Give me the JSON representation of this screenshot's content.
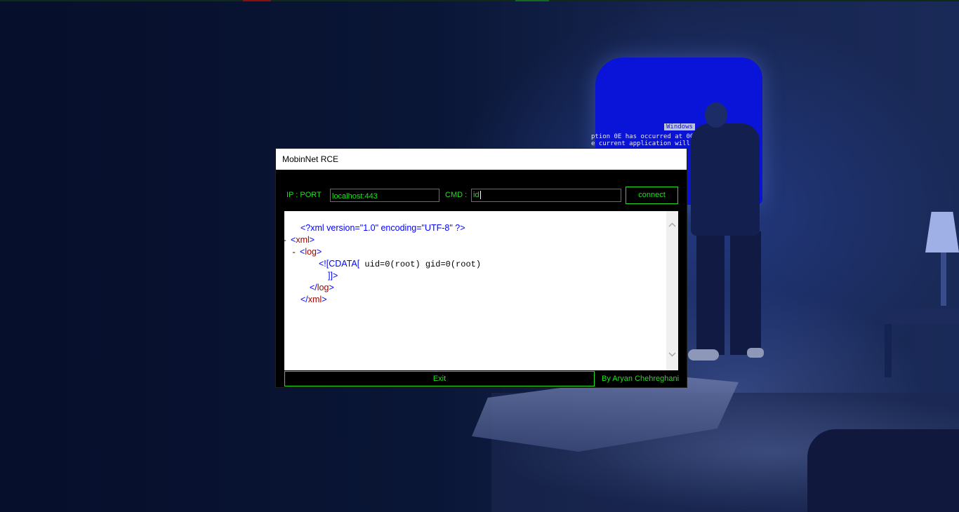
{
  "window": {
    "title": "MobinNet RCE"
  },
  "connection": {
    "ip_port_label": "IP : PORT",
    "ip_port_value": "localhost:443",
    "cmd_label": "CMD :",
    "cmd_value": "id",
    "connect_label": "connect"
  },
  "output": {
    "lines": [
      {
        "toggle": "",
        "indent": 1,
        "parts": [
          [
            "pi",
            "<?xml version=\"1.0\" encoding=\"UTF-8\" ?>"
          ]
        ]
      },
      {
        "toggle": "-",
        "indent": 0,
        "parts": [
          [
            "br",
            "<"
          ],
          [
            "tag",
            "xml"
          ],
          [
            "br",
            ">"
          ]
        ]
      },
      {
        "toggle": "-",
        "indent": 1,
        "parts": [
          [
            "br",
            "<"
          ],
          [
            "tag",
            "log"
          ],
          [
            "br",
            ">"
          ]
        ]
      },
      {
        "toggle": "",
        "indent": 3,
        "parts": [
          [
            "cdata",
            "<![CDATA["
          ],
          [
            "mono",
            " uid=0(root) gid=0(root)"
          ]
        ]
      },
      {
        "toggle": "",
        "indent": 4,
        "parts": [
          [
            "cdata",
            "]]>"
          ]
        ]
      },
      {
        "toggle": "",
        "indent": 2,
        "parts": [
          [
            "br",
            "</"
          ],
          [
            "tag",
            "log"
          ],
          [
            "br",
            ">"
          ]
        ]
      },
      {
        "toggle": "",
        "indent": 1,
        "parts": [
          [
            "br",
            "</"
          ],
          [
            "tag",
            "xml"
          ],
          [
            "br",
            ">"
          ]
        ]
      }
    ],
    "scroll_up_icon": "chevron-up-icon",
    "scroll_down_icon": "chevron-down-icon"
  },
  "footer": {
    "exit_label": "Exit",
    "credit": "By Aryan Chehreghani"
  },
  "wallpaper": {
    "bsod_label": "Windows",
    "bsod_text": "ption 0E has occurred at 0028:   8F\ne current application will be"
  },
  "colors": {
    "accent_green": "#20e020",
    "window_bg": "#000000",
    "xml_blue": "#0000ff",
    "xml_tag": "#990000"
  }
}
